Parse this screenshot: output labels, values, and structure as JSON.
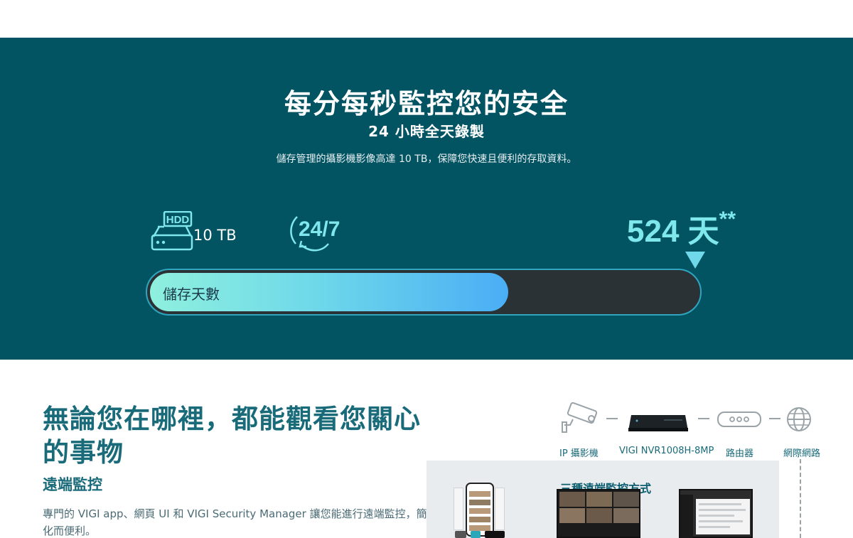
{
  "hero": {
    "title": "每分每秒監控您的安全",
    "subtitle": "24 小時全天錄製",
    "description": "儲存管理的攝影機影像高達 10 TB，保障您快速且便利的存取資料。",
    "hdd_icon_text": "HDD",
    "hdd_capacity": "10 TB",
    "badge_247": "24/7",
    "days_value": "524 天",
    "days_footnote": "**",
    "progress_label": "儲存天數",
    "progress_fraction": 0.655
  },
  "remote": {
    "title": "無論您在哪裡，都能觀看您關心的事物",
    "subtitle": "遠端監控",
    "description": "專門的 VIGI app、網頁 UI 和 VIGI Security Manager 讓您能進行遠端監控，簡化而便利。"
  },
  "topology": {
    "labels": [
      "IP 攝影機",
      "VIGI NVR1008H-8MP",
      "路由器",
      "網際網路"
    ]
  },
  "panel": {
    "title": "三種遠端監控方式"
  },
  "colors": {
    "hero_bg": "#025463",
    "accent_teal": "#7fe8ec",
    "heading_teal": "#1a6b7a"
  }
}
